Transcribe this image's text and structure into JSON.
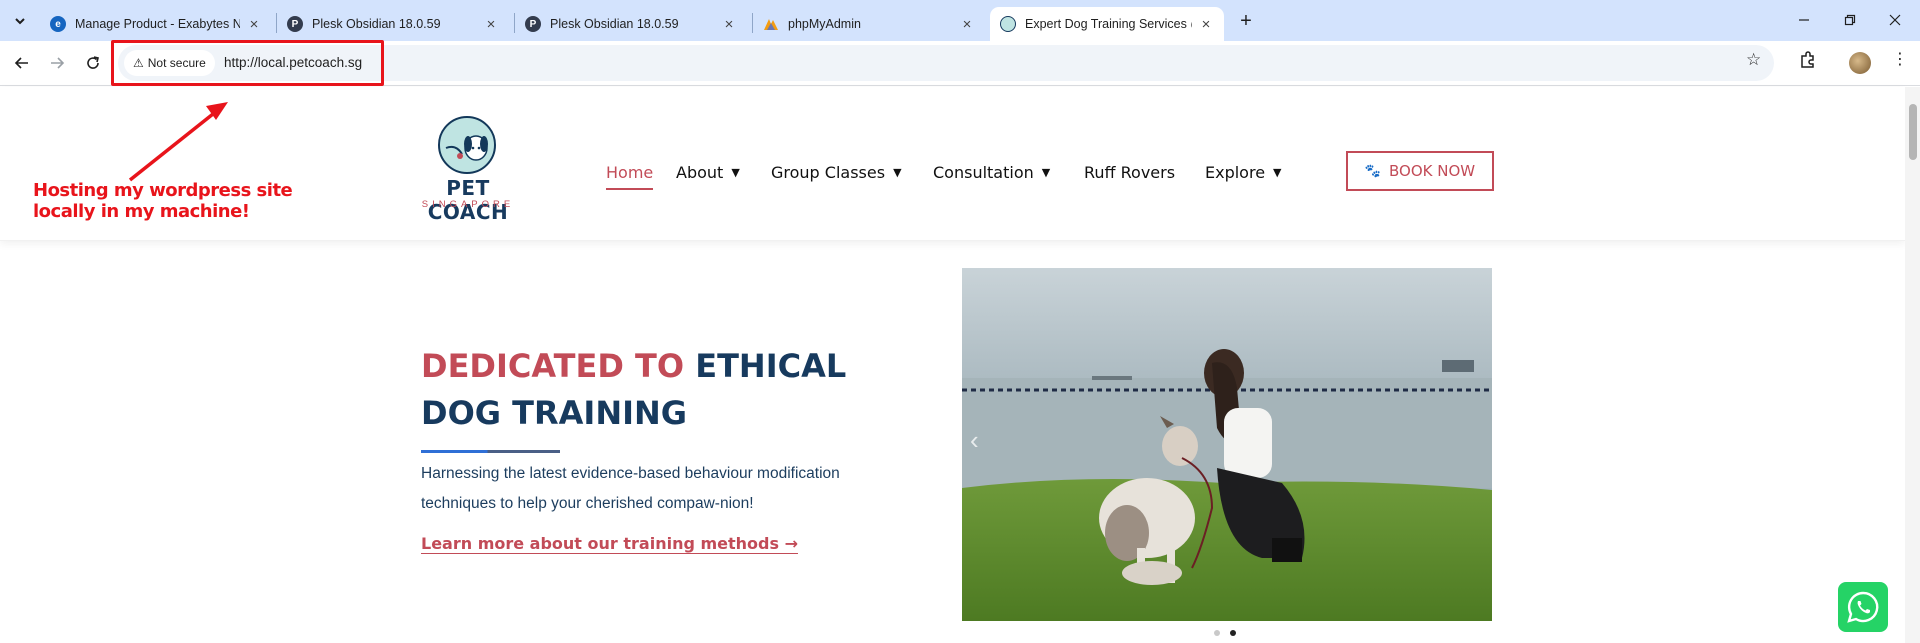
{
  "browser": {
    "tabs": [
      {
        "title": "Manage Product - Exabytes Net",
        "active": false
      },
      {
        "title": "Plesk Obsidian 18.0.59",
        "active": false
      },
      {
        "title": "Plesk Obsidian 18.0.59",
        "active": false
      },
      {
        "title": "phpMyAdmin",
        "active": false
      },
      {
        "title": "Expert Dog Training Services @",
        "active": true
      }
    ],
    "security_label": "Not secure",
    "url": "http://local.petcoach.sg"
  },
  "annotation": {
    "line1": "Hosting my wordpress site",
    "line2": "locally in my machine!"
  },
  "site": {
    "logo_text": "PET COACH",
    "logo_sub": "SINGAPORE",
    "nav": [
      {
        "label": "Home",
        "dropdown": false,
        "active": true
      },
      {
        "label": "About",
        "dropdown": true,
        "active": false
      },
      {
        "label": "Group Classes",
        "dropdown": true,
        "active": false
      },
      {
        "label": "Consultation",
        "dropdown": true,
        "active": false
      },
      {
        "label": "Ruff Rovers",
        "dropdown": false,
        "active": false
      },
      {
        "label": "Explore",
        "dropdown": true,
        "active": false
      }
    ],
    "book_button": "BOOK NOW",
    "hero": {
      "title_pink": "DEDICATED TO",
      "title_blue_1": "ETHICAL",
      "title_blue_2": "DOG TRAINING",
      "text": "Harnessing the latest evidence-based behaviour modification techniques to help your cherished compaw-nion!",
      "link": "Learn more about our training methods →"
    },
    "slider": {
      "current_slide": 2,
      "total_slides": 2
    }
  },
  "colors": {
    "brand_navy": "#173a5e",
    "brand_pink": "#c24b57",
    "annotation_red": "#e8141b",
    "whatsapp_green": "#25d366"
  }
}
